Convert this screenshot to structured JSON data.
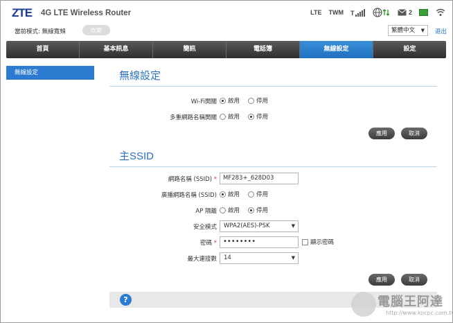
{
  "header": {
    "logo": "ZTE",
    "product": "4G LTE Wireless Router",
    "network_type": "LTE",
    "carrier": "TWM",
    "sms_count": "2"
  },
  "modebar": {
    "mode_label": "當前模式: 無線寬頻",
    "mode_button": "改變",
    "language": "繁體中文",
    "logout": "退出"
  },
  "nav": {
    "items": [
      "首頁",
      "基本訊息",
      "簡訊",
      "電話簿",
      "無線設定",
      "設定"
    ],
    "active_index": 4
  },
  "sidebar": {
    "items": [
      "無線設定"
    ]
  },
  "wireless": {
    "title": "無線設定",
    "wifi_switch_label": "Wi-Fi開關",
    "multi_ssid_label": "多重網路名稱開關",
    "enable": "啟用",
    "disable": "停用",
    "wifi_switch_value": "啟用",
    "multi_ssid_value": "停用",
    "apply": "應用",
    "cancel": "取消"
  },
  "ssid": {
    "title": "主SSID",
    "name_label": "網路名稱 (SSID)",
    "name_required": "*",
    "name_value": "MF283+_628D03",
    "broadcast_label": "廣播網路名稱 (SSID)",
    "broadcast_value": "啟用",
    "isolation_label": "AP 隔離",
    "isolation_value": "停用",
    "security_label": "安全模式",
    "security_value": "WPA2(AES)-PSK",
    "password_label": "密碼",
    "password_required": "*",
    "password_value": "••••••••",
    "show_password": "顯示密碼",
    "max_connections_label": "最大連接數",
    "max_connections_value": "14",
    "enable": "啟用",
    "disable": "停用",
    "apply": "應用",
    "cancel": "取消"
  },
  "footer": {
    "help": "?"
  },
  "watermark": {
    "text": "電腦王阿達",
    "url": "http://www.kocpc.com.tw"
  },
  "colors": {
    "accent": "#2b7bd0",
    "nav_dark": "#3a3a3a",
    "title_blue": "#2b6fbf"
  }
}
